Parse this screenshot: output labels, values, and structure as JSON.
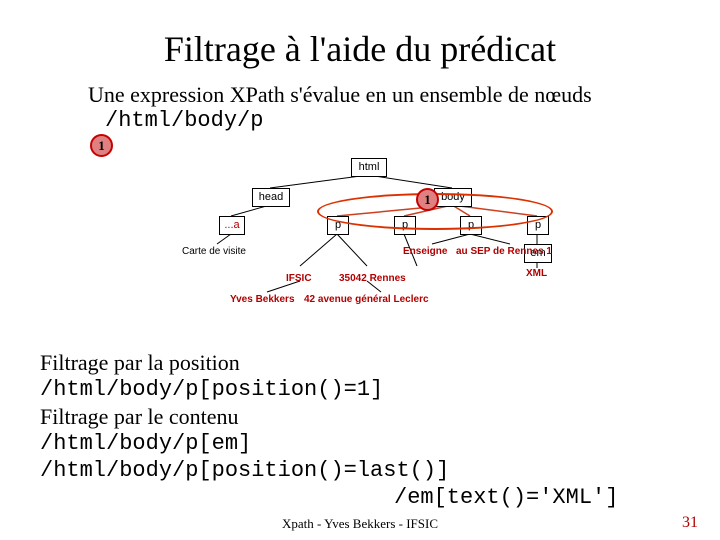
{
  "title": "Filtrage à l'aide du prédicat",
  "intro": "Une expression XPath s'évalue en un ensemble de nœuds",
  "xpath_expr": "/html/body/p",
  "badges": {
    "one": "1",
    "two": "1"
  },
  "tree": {
    "root": "html",
    "level2": {
      "head": "head",
      "body": "body"
    },
    "head_children": [
      "...a"
    ],
    "body_children": [
      "p",
      "p",
      "p",
      "p"
    ],
    "p4_child": "em",
    "leaf_texts": {
      "carte": "Carte de visite",
      "enseigne": "Enseigne",
      "sep": "au SEP de Rennes 1",
      "ifsic": "IFSIC",
      "cp": "35042 Rennes",
      "xml": "XML",
      "yves": "Yves Bekkers",
      "addr": "42 avenue général Leclerc"
    }
  },
  "filters": {
    "by_position_label": "Filtrage par la position",
    "by_position_expr": "/html/body/p[position()=1]",
    "by_content_label": "Filtrage par le contenu",
    "by_content_expr1": "/html/body/p[em]",
    "by_content_expr2": "/html/body/p[position()=last()]",
    "by_content_expr3": "/em[text()='XML']"
  },
  "footer": "Xpath - Yves Bekkers - IFSIC",
  "page_number": "31"
}
